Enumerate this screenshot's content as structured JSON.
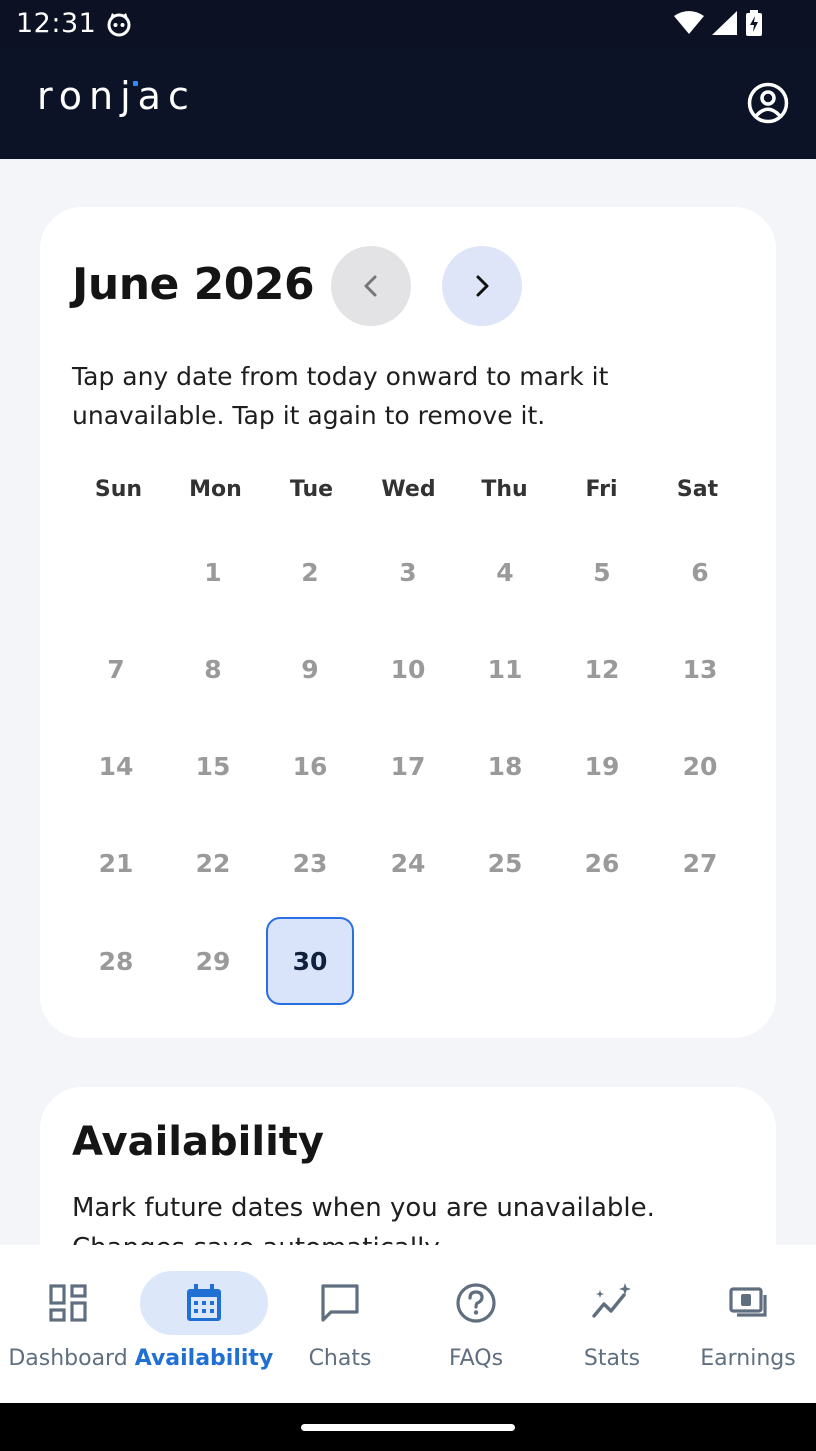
{
  "status_bar": {
    "time": "12:31"
  },
  "header": {
    "brand": "ronjac"
  },
  "calendar": {
    "month_title": "June 2026",
    "description": "Tap any date from today onward to mark it unavailable. Tap it again to remove it.",
    "weekdays": [
      "Sun",
      "Mon",
      "Tue",
      "Wed",
      "Thu",
      "Fri",
      "Sat"
    ],
    "days": [
      "1",
      "2",
      "3",
      "4",
      "5",
      "6",
      "7",
      "8",
      "9",
      "10",
      "11",
      "12",
      "13",
      "14",
      "15",
      "16",
      "17",
      "18",
      "19",
      "20",
      "21",
      "22",
      "23",
      "24",
      "25",
      "26",
      "27",
      "28",
      "29",
      "30"
    ],
    "today": "30"
  },
  "availability": {
    "title": "Availability",
    "description": "Mark future dates when you are unavailable. Changes save automatically."
  },
  "bottom_nav": {
    "items": [
      {
        "label": "Dashboard",
        "icon": "dashboard-icon",
        "active": false
      },
      {
        "label": "Availability",
        "icon": "calendar-icon",
        "active": true
      },
      {
        "label": "Chats",
        "icon": "chat-icon",
        "active": false
      },
      {
        "label": "FAQs",
        "icon": "help-icon",
        "active": false
      },
      {
        "label": "Stats",
        "icon": "stats-icon",
        "active": false
      },
      {
        "label": "Earnings",
        "icon": "earnings-icon",
        "active": false
      }
    ]
  },
  "colors": {
    "accent": "#2070d4",
    "header_bg": "#0c1327",
    "today_bg": "#d9e4fb"
  }
}
